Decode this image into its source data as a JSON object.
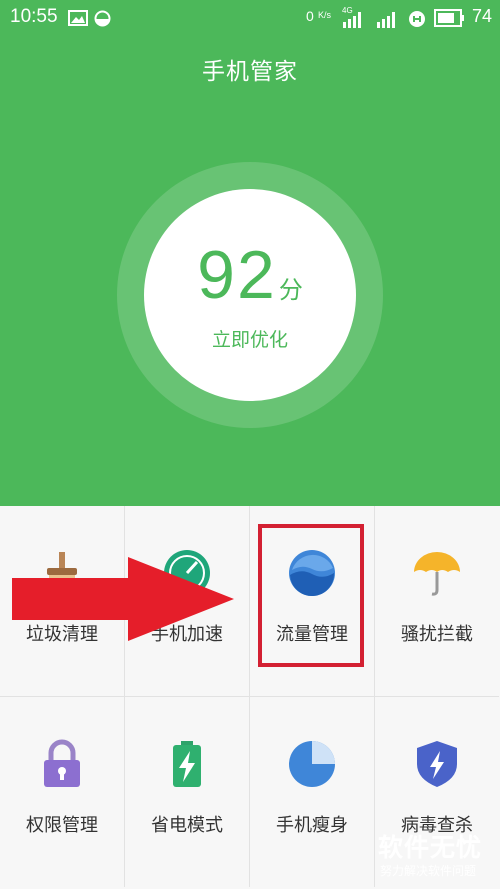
{
  "status_bar": {
    "time": "10:55",
    "net_speed": "0",
    "net_speed_unit": "K/s",
    "signal_label": "4G",
    "battery": "74"
  },
  "header": {
    "title": "手机管家"
  },
  "score": {
    "value": "92",
    "unit": "分",
    "action": "立即优化"
  },
  "tools": [
    {
      "label": "垃圾清理",
      "icon": "broom-icon"
    },
    {
      "label": "手机加速",
      "icon": "speedometer-icon"
    },
    {
      "label": "流量管理",
      "icon": "data-traffic-icon"
    },
    {
      "label": "骚扰拦截",
      "icon": "umbrella-icon"
    },
    {
      "label": "权限管理",
      "icon": "lock-icon"
    },
    {
      "label": "省电模式",
      "icon": "battery-icon"
    },
    {
      "label": "手机瘦身",
      "icon": "pie-chart-icon"
    },
    {
      "label": "病毒查杀",
      "icon": "shield-icon"
    }
  ],
  "watermark": {
    "title": "软件无忧",
    "subtitle": "努力解决软件问题"
  },
  "colors": {
    "brand_green": "#4cb85a",
    "highlight_red": "#d32032"
  }
}
